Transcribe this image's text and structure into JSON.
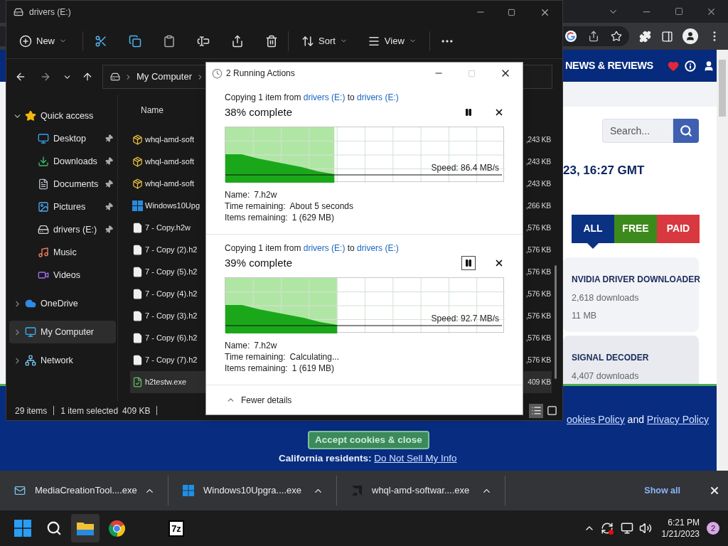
{
  "explorer": {
    "title": "drivers (E:)",
    "new_label": "New",
    "sort_label": "Sort",
    "view_label": "View",
    "breadcrumb": [
      "My Computer"
    ],
    "nav": [
      {
        "label": "Quick access",
        "kind": "star",
        "expanded": true,
        "selected": false,
        "children": [
          {
            "label": "Desktop",
            "kind": "desktop",
            "pinned": true,
            "selected": false
          },
          {
            "label": "Downloads",
            "kind": "downloads",
            "pinned": true,
            "selected": false
          },
          {
            "label": "Documents",
            "kind": "documents",
            "pinned": true,
            "selected": false
          },
          {
            "label": "Pictures",
            "kind": "pictures",
            "pinned": true,
            "selected": false
          },
          {
            "label": "drivers (E:)",
            "kind": "drive",
            "pinned": true,
            "selected": false
          },
          {
            "label": "Music",
            "kind": "music",
            "pinned": false,
            "selected": false
          },
          {
            "label": "Videos",
            "kind": "videos",
            "pinned": false,
            "selected": false
          }
        ]
      },
      {
        "label": "OneDrive",
        "kind": "onedrive",
        "expanded": false,
        "selected": false
      },
      {
        "label": "My Computer",
        "kind": "computer",
        "expanded": false,
        "selected": true
      },
      {
        "label": "Network",
        "kind": "network",
        "expanded": false,
        "selected": false
      }
    ],
    "column_header": "Name",
    "files": [
      {
        "name": "whql-amd-soft",
        "size": ",243 KB",
        "kind": "installer",
        "selected": false
      },
      {
        "name": "whql-amd-soft",
        "size": ",243 KB",
        "kind": "installer",
        "selected": false
      },
      {
        "name": "whql-amd-soft",
        "size": ",243 KB",
        "kind": "installer",
        "selected": false
      },
      {
        "name": "Windows10Upg",
        "size": ",266 KB",
        "kind": "windows",
        "selected": false
      },
      {
        "name": "7 - Copy.h2w",
        "size": ",576 KB",
        "kind": "file",
        "selected": false
      },
      {
        "name": "7 - Copy (2).h2",
        "size": ",576 KB",
        "kind": "file",
        "selected": false
      },
      {
        "name": "7 - Copy (5).h2",
        "size": ",576 KB",
        "kind": "file",
        "selected": false
      },
      {
        "name": "7 - Copy (4).h2",
        "size": ",576 KB",
        "kind": "file",
        "selected": false
      },
      {
        "name": "7 - Copy (3).h2",
        "size": ",576 KB",
        "kind": "file",
        "selected": false
      },
      {
        "name": "7 - Copy (6).h2",
        "size": ",576 KB",
        "kind": "file",
        "selected": false
      },
      {
        "name": "7 - Copy (7).h2",
        "size": ",576 KB",
        "kind": "file",
        "selected": false
      },
      {
        "name": "h2testw.exe",
        "size": "409 KB",
        "kind": "exe",
        "selected": true
      }
    ],
    "status": {
      "count": "29 items",
      "selection": "1 item selected",
      "size": "409 KB"
    },
    "view_modes": [
      {
        "kind": "details",
        "selected": true
      },
      {
        "kind": "tiles",
        "selected": false
      }
    ]
  },
  "dialog": {
    "title": "2 Running Actions",
    "footer": "Fewer details",
    "operations": [
      {
        "prefix": "Copying 1 item from",
        "source": "drivers (E:)",
        "connector": "to",
        "target": "drivers (E:)",
        "progress": "38% complete",
        "level": 0.39,
        "speed": "Speed: 86.4 MB/s",
        "pause_focused": false,
        "details": [
          {
            "label": "Name:",
            "value": "7.h2w"
          },
          {
            "label": "Time remaining:",
            "value": "About 5 seconds"
          },
          {
            "label": "Items remaining:",
            "value": "1 (629 MB)"
          }
        ]
      },
      {
        "prefix": "Copying 1 item from",
        "source": "drivers (E:)",
        "connector": "to",
        "target": "drivers (E:)",
        "progress": "39% complete",
        "level": 0.4,
        "speed": "Speed: 92.7 MB/s",
        "pause_focused": true,
        "details": [
          {
            "label": "Name:",
            "value": "7.h2w"
          },
          {
            "label": "Time remaining:",
            "value": "Calculating..."
          },
          {
            "label": "Items remaining:",
            "value": "1 (619 MB)"
          }
        ]
      }
    ]
  },
  "browser": {
    "nav_title": "NEWS & REVIEWS",
    "search_placeholder": "Search...",
    "timestamp": "23, 16:27 GMT",
    "filters": [
      {
        "label": "ALL",
        "color": "#0b3183",
        "selected": true
      },
      {
        "label": "FREE",
        "color": "#3d8a1c",
        "selected": false
      },
      {
        "label": "PAID",
        "color": "#d8383f",
        "selected": false
      }
    ],
    "cards": [
      {
        "title": "NVIDIA DRIVER DOWNLOADER",
        "downloads": "2,618 downloads",
        "size": "11 MB"
      },
      {
        "title": "SIGNAL DECODER",
        "downloads": "4,407 downloads"
      }
    ],
    "cookie_banner": {
      "cookies_link": "ookies Policy",
      "and": "and",
      "privacy_link": "Privacy Policy",
      "accept": "Accept cookies & close",
      "california": "California residents:",
      "opt_out_link": "Do Not Sell My Info"
    }
  },
  "downloads_bar": {
    "items": [
      {
        "name": "MediaCreationTool....exe",
        "kind": "mediatool"
      },
      {
        "name": "Windows10Upgra....exe",
        "kind": "windows"
      },
      {
        "name": "whql-amd-softwar....exe",
        "kind": "amd"
      }
    ],
    "show_all": "Show all"
  },
  "taskbar": {
    "apps": [
      {
        "kind": "start",
        "active": false
      },
      {
        "kind": "search",
        "active": false
      },
      {
        "kind": "explorer",
        "active": true
      },
      {
        "kind": "chrome",
        "active": false
      },
      {
        "kind": "sevenzip",
        "label": "7z",
        "active": false
      }
    ],
    "time": "6:21 PM",
    "date": "1/21/2023",
    "notifications": "2"
  }
}
